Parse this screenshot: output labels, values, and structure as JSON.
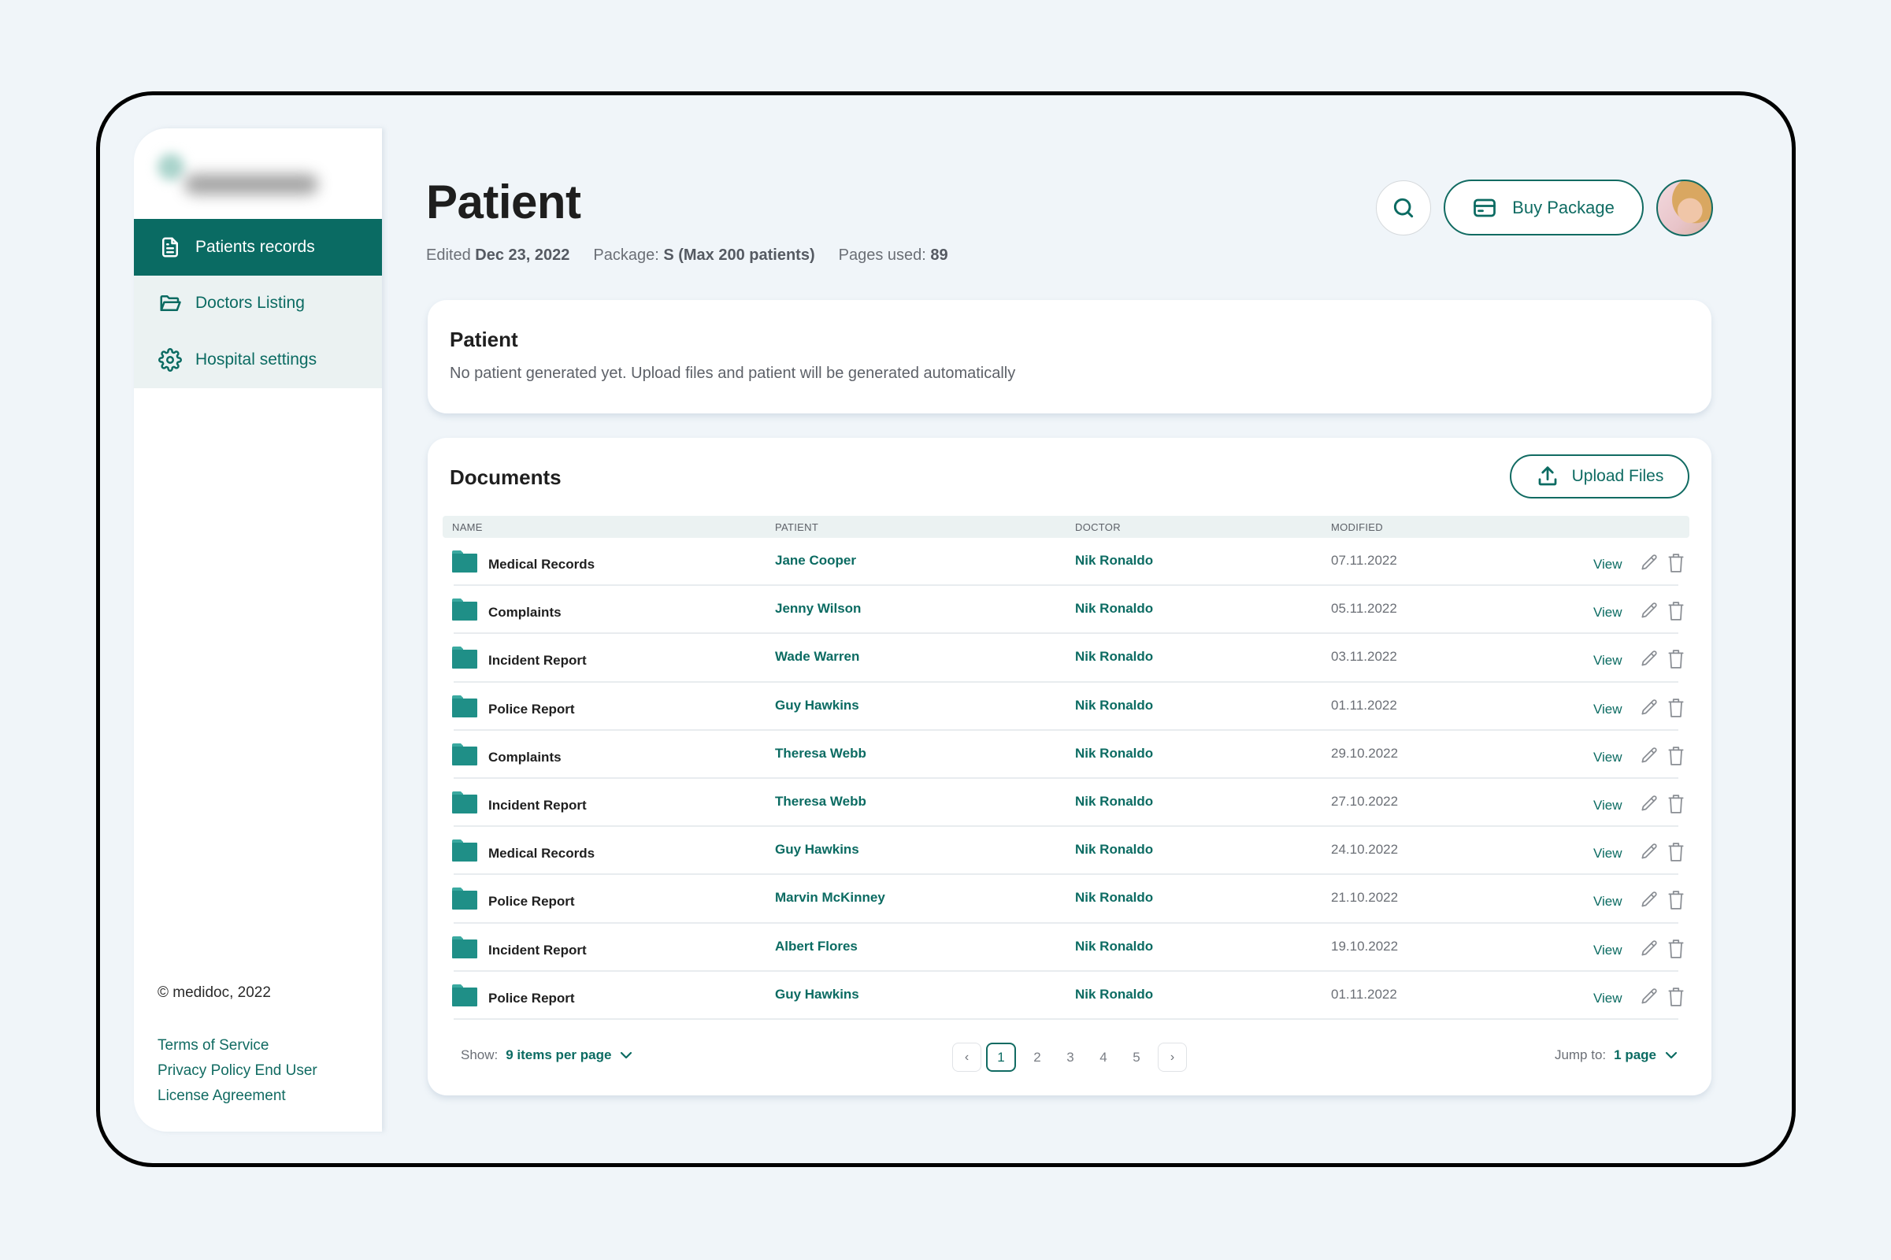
{
  "app": {
    "brand": "medidoc",
    "logo_icon": "blurred-logo-icon"
  },
  "sidebar": {
    "items": [
      {
        "label": "Patients records",
        "icon": "document-icon",
        "active": true
      },
      {
        "label": "Doctors Listing",
        "icon": "folder-open-icon",
        "active": false
      },
      {
        "label": "Hospital settings",
        "icon": "gear-icon",
        "active": false
      }
    ],
    "copyright": "© medidoc, 2022",
    "links": [
      "Terms of Service",
      "Privacy Policy End User",
      "License Agreement"
    ]
  },
  "header": {
    "title": "Patient",
    "edited_label": "Edited",
    "edited_value": "Dec 23, 2022",
    "package_label": "Package:",
    "package_value": "S (Max 200 patients)",
    "pages_label": "Pages used:",
    "pages_value": "89",
    "search_icon": "search-icon",
    "buy_label": "Buy Package",
    "buy_icon": "credit-card-icon",
    "avatar_alt": "user avatar"
  },
  "patient_card": {
    "title": "Patient",
    "text": "No patient generated yet. Upload files and patient will be generated automatically"
  },
  "documents": {
    "title": "Documents",
    "upload_label": "Upload Files",
    "columns": [
      "NAME",
      "PATIENT",
      "DOCTOR",
      "MODIFIED"
    ],
    "view_label": "View",
    "rows": [
      {
        "name": "Medical Records",
        "patient": "Jane Cooper",
        "doctor": "Nik Ronaldo",
        "modified": "07.11.2022"
      },
      {
        "name": "Complaints",
        "patient": "Jenny Wilson",
        "doctor": "Nik Ronaldo",
        "modified": "05.11.2022"
      },
      {
        "name": "Incident Report",
        "patient": "Wade Warren",
        "doctor": "Nik Ronaldo",
        "modified": "03.11.2022"
      },
      {
        "name": "Police Report",
        "patient": "Guy Hawkins",
        "doctor": "Nik Ronaldo",
        "modified": "01.11.2022"
      },
      {
        "name": "Complaints",
        "patient": "Theresa Webb",
        "doctor": "Nik Ronaldo",
        "modified": "29.10.2022"
      },
      {
        "name": "Incident Report",
        "patient": "Theresa Webb",
        "doctor": "Nik Ronaldo",
        "modified": "27.10.2022"
      },
      {
        "name": "Medical Records",
        "patient": "Guy Hawkins",
        "doctor": "Nik Ronaldo",
        "modified": "24.10.2022"
      },
      {
        "name": "Police Report",
        "patient": "Marvin McKinney",
        "doctor": "Nik Ronaldo",
        "modified": "21.10.2022"
      },
      {
        "name": "Incident Report",
        "patient": "Albert Flores",
        "doctor": "Nik Ronaldo",
        "modified": "19.10.2022"
      },
      {
        "name": "Police Report",
        "patient": "Guy Hawkins",
        "doctor": "Nik Ronaldo",
        "modified": "01.11.2022"
      }
    ],
    "footer": {
      "show_label": "Show:",
      "show_value": "9 items per page",
      "pages": [
        "1",
        "2",
        "3",
        "4",
        "5"
      ],
      "current_page": "1",
      "prev": "‹",
      "next": "›",
      "jump_label": "Jump to:",
      "jump_value": "1 page"
    }
  },
  "colors": {
    "primary": "#0a6b63",
    "nav_bg": "#ebf2f2",
    "page_bg": "#f0f5f9",
    "folder": "#1f8f87"
  }
}
